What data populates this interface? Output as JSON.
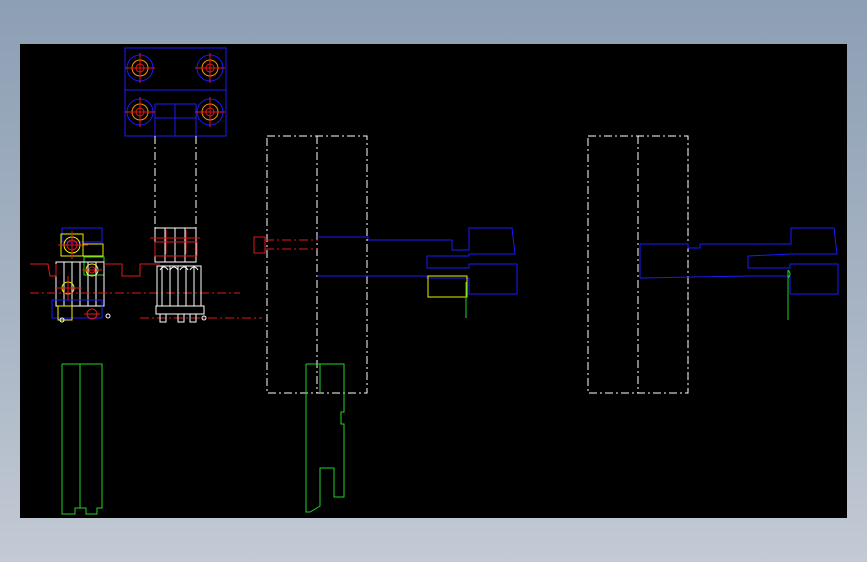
{
  "viewer": {
    "background": "#000000",
    "frame_background": "#9aa9bb"
  },
  "palette": {
    "blue": "#1a1aff",
    "white": "#ffffff",
    "green": "#22d322",
    "red": "#e01818",
    "yellow": "#f0f000",
    "orange": "#ff8c00"
  },
  "drawing": {
    "views": [
      "top-view-plate",
      "front-view-mechanism",
      "side-view-left-mould",
      "side-view-right-mould"
    ],
    "annotations": []
  }
}
